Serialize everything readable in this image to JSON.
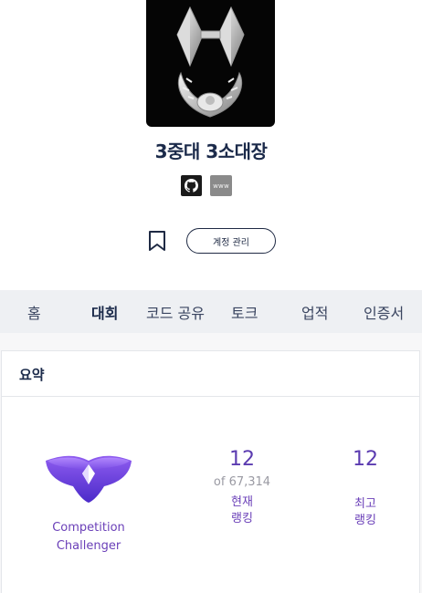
{
  "profile": {
    "username": "3중대 3소대장",
    "links": {
      "website_label": "www"
    },
    "manage_button": "계정 관리"
  },
  "tabs": [
    {
      "label": "홈",
      "active": false
    },
    {
      "label": "대회",
      "active": true
    },
    {
      "label": "코드 공유",
      "active": false
    },
    {
      "label": "토크",
      "active": false
    },
    {
      "label": "업적",
      "active": false
    },
    {
      "label": "인증서",
      "active": false
    }
  ],
  "summary": {
    "title": "요약",
    "tier_line1": "Competition",
    "tier_line2": "Challenger",
    "current_rank": {
      "value": "12",
      "total": "of 67,314",
      "label_line1": "현재",
      "label_line2": "랭킹"
    },
    "best_rank": {
      "value": "12",
      "label_line1": "최고",
      "label_line2": "랭킹"
    }
  },
  "colors": {
    "accent_purple": "#5b3bb0",
    "navy": "#1b2a4a",
    "tab_bar": "#eef0f3"
  }
}
